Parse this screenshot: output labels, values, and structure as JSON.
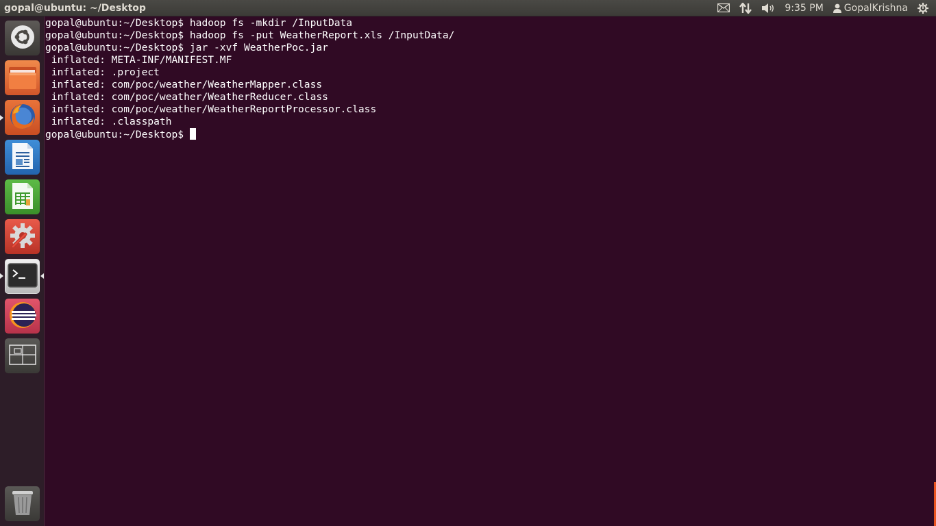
{
  "top_panel": {
    "window_title": "gopal@ubuntu: ~/Desktop",
    "indicators": {
      "mail_icon": "envelope-icon",
      "network_icon": "network-arrows-icon",
      "sound_icon": "speaker-icon",
      "time": "9:35 PM",
      "user_name": "GopalKrishna",
      "session_icon": "gear-power-icon"
    }
  },
  "launcher": {
    "items": [
      {
        "name": "Dash",
        "icon": "ubuntu-logo-icon"
      },
      {
        "name": "Files",
        "icon": "folder-icon"
      },
      {
        "name": "Firefox",
        "icon": "firefox-icon"
      },
      {
        "name": "LibreOffice Writer",
        "icon": "writer-icon"
      },
      {
        "name": "LibreOffice Calc",
        "icon": "calc-icon"
      },
      {
        "name": "System Settings",
        "icon": "settings-icon"
      },
      {
        "name": "Terminal",
        "icon": "terminal-icon"
      },
      {
        "name": "Eclipse",
        "icon": "eclipse-icon"
      },
      {
        "name": "Workspace Switcher",
        "icon": "workspace-icon"
      },
      {
        "name": "Trash",
        "icon": "trash-icon"
      }
    ],
    "accent_color": "#e95420"
  },
  "terminal": {
    "background": "#300a24",
    "lines": [
      "gopal@ubuntu:~/Desktop$ hadoop fs -mkdir /InputData",
      "gopal@ubuntu:~/Desktop$ hadoop fs -put WeatherReport.xls /InputData/",
      "gopal@ubuntu:~/Desktop$ jar -xvf WeatherPoc.jar",
      " inflated: META-INF/MANIFEST.MF",
      " inflated: .project",
      " inflated: com/poc/weather/WeatherMapper.class",
      " inflated: com/poc/weather/WeatherReducer.class",
      " inflated: com/poc/weather/WeatherReportProcessor.class",
      " inflated: .classpath"
    ],
    "prompt": "gopal@ubuntu:~/Desktop$ "
  }
}
